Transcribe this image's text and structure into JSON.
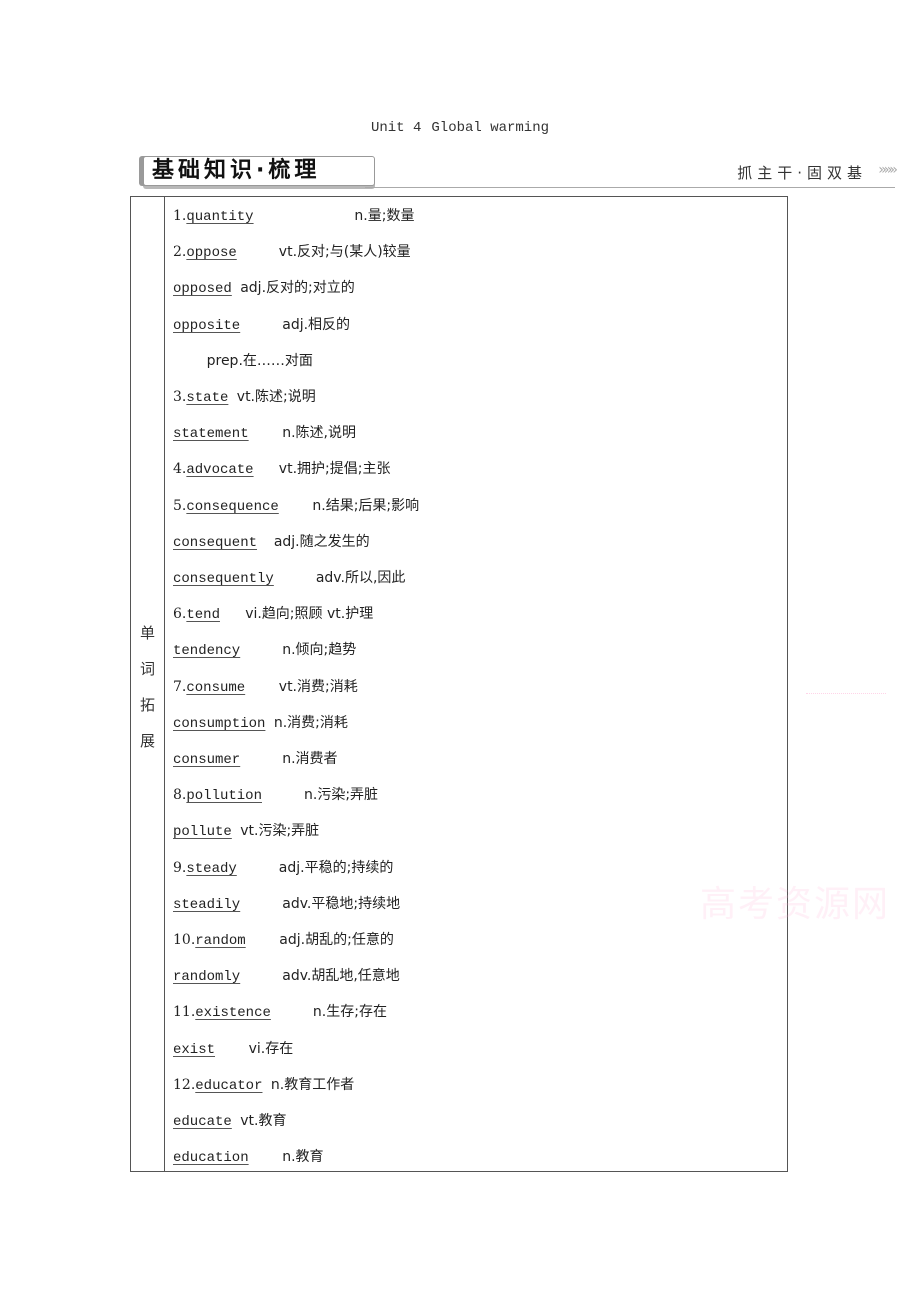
{
  "header": {
    "unit": "Unit 4",
    "title": "Global warming"
  },
  "section": {
    "label": "基础知识·梳理",
    "subtitle": "抓主干·固双基",
    "arrows": "»»»"
  },
  "table": {
    "side_label": [
      "单",
      "词",
      "拓",
      "展"
    ],
    "entries": [
      {
        "num": "1.",
        "word": "quantity",
        "gap": "            ",
        "def": "n.量;数量"
      },
      {
        "num": "2.",
        "word": "oppose",
        "gap": "     ",
        "def": "vt.反对;与(某人)较量"
      },
      {
        "num": "",
        "word": "opposed",
        "gap": " ",
        "def": "adj.反对的;对立的"
      },
      {
        "num": "",
        "word": "opposite",
        "gap": "     ",
        "def": "adj.相反的"
      },
      {
        "num": "",
        "word": "",
        "gap": "    ",
        "def": "prep.在……对面"
      },
      {
        "num": "3.",
        "word": "state",
        "gap": " ",
        "def": "vt.陈述;说明"
      },
      {
        "num": "",
        "word": "statement",
        "gap": "    ",
        "def": "n.陈述,说明"
      },
      {
        "num": "4.",
        "word": "advocate",
        "gap": "   ",
        "def": "vt.拥护;提倡;主张"
      },
      {
        "num": "5.",
        "word": "consequence",
        "gap": "    ",
        "def": "n.结果;后果;影响"
      },
      {
        "num": "",
        "word": "consequent",
        "gap": "  ",
        "def": "adj.随之发生的"
      },
      {
        "num": "",
        "word": "consequently",
        "gap": "     ",
        "def": "adv.所以,因此"
      },
      {
        "num": "6.",
        "word": "tend",
        "gap": "   ",
        "def": "vi.趋向;照顾 vt.护理"
      },
      {
        "num": "",
        "word": "tendency",
        "gap": "     ",
        "def": "n.倾向;趋势"
      },
      {
        "num": "7.",
        "word": "consume",
        "gap": "    ",
        "def": "vt.消费;消耗"
      },
      {
        "num": "",
        "word": "consumption",
        "gap": " ",
        "def": "n.消费;消耗"
      },
      {
        "num": "",
        "word": "consumer",
        "gap": "     ",
        "def": "n.消费者"
      },
      {
        "num": "8.",
        "word": "pollution",
        "gap": "     ",
        "def": "n.污染;弄脏"
      },
      {
        "num": "",
        "word": "pollute",
        "gap": " ",
        "def": "vt.污染;弄脏"
      },
      {
        "num": "9.",
        "word": "steady",
        "gap": "     ",
        "def": "adj.平稳的;持续的"
      },
      {
        "num": "",
        "word": "steadily",
        "gap": "     ",
        "def": "adv.平稳地;持续地"
      },
      {
        "num": "10.",
        "word": "random",
        "gap": "    ",
        "def": "adj.胡乱的;任意的"
      },
      {
        "num": "",
        "word": "randomly",
        "gap": "     ",
        "def": "adv.胡乱地,任意地"
      },
      {
        "num": "11.",
        "word": "existence",
        "gap": "     ",
        "def": "n.生存;存在"
      },
      {
        "num": "",
        "word": "exist",
        "gap": "    ",
        "def": "vi.存在"
      },
      {
        "num": "12.",
        "word": "educator",
        "gap": " ",
        "def": "n.教育工作者"
      },
      {
        "num": "",
        "word": "educate",
        "gap": " ",
        "def": "vt.教育"
      },
      {
        "num": "",
        "word": "education",
        "gap": "    ",
        "def": "n.教育"
      }
    ]
  },
  "watermark": "高考资源网"
}
